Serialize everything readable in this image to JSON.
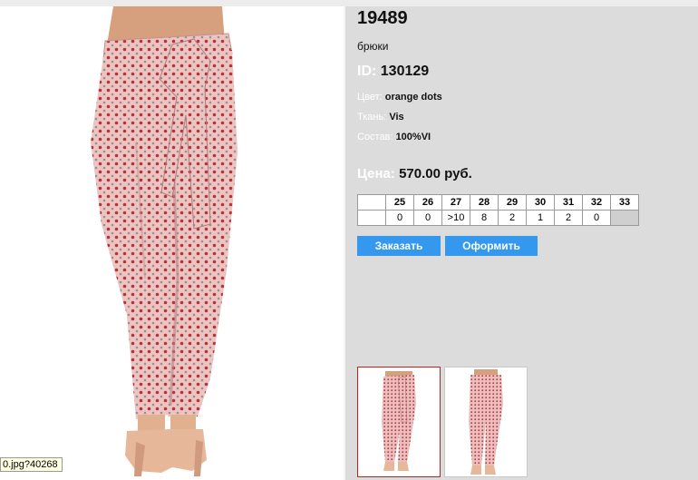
{
  "product": {
    "sku": "19489",
    "type": "брюки",
    "id_label": "ID:",
    "id_value": "130129",
    "color_label": "Цвет:",
    "color_value": "orange dots",
    "fabric_label": "Ткань:",
    "fabric_value": "Vis",
    "composition_label": "Состав:",
    "composition_value": "100%VI",
    "price_label": "Цена:",
    "price_value": "570.00 руб."
  },
  "sizes": {
    "labels": [
      "25",
      "26",
      "27",
      "28",
      "29",
      "30",
      "31",
      "32",
      "33"
    ],
    "stock": [
      "0",
      "0",
      ">10",
      "8",
      "2",
      "1",
      "2",
      "0",
      ""
    ]
  },
  "buttons": {
    "order": "Заказать",
    "checkout": "Оформить"
  },
  "status_tip": "0.jpg?40268",
  "colors": {
    "accent": "#3398ee",
    "background": "#dcdcdc",
    "selected_thumb_border": "#c0221e",
    "fabric_pink": "#e8b2b4",
    "dot_red": "#b8323c"
  },
  "icons": [
    "product-photo-trousers",
    "thumbnail-front",
    "thumbnail-back"
  ]
}
